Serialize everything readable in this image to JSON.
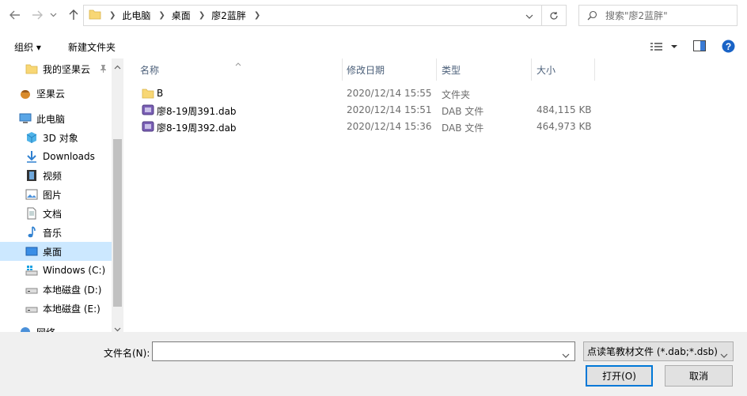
{
  "address": {
    "crumbs": [
      "此电脑",
      "桌面",
      "廖2蓝胖"
    ]
  },
  "search": {
    "placeholder": "搜索\"廖2蓝胖\""
  },
  "toolbar": {
    "organize_label": "组织 ▾",
    "new_folder_label": "新建文件夹"
  },
  "sidebar": {
    "items": [
      {
        "label": "我的坚果云",
        "icon": "folder-icon",
        "pinned": true
      },
      {
        "label": "坚果云",
        "icon": "nut-icon"
      },
      {
        "label": "此电脑",
        "icon": "computer-icon"
      },
      {
        "label": "3D 对象",
        "icon": "cube-icon"
      },
      {
        "label": "Downloads",
        "icon": "download-arrow-icon"
      },
      {
        "label": "视频",
        "icon": "film-icon"
      },
      {
        "label": "图片",
        "icon": "picture-icon"
      },
      {
        "label": "文档",
        "icon": "document-icon"
      },
      {
        "label": "音乐",
        "icon": "music-note-icon"
      },
      {
        "label": "桌面",
        "icon": "desktop-icon",
        "selected": true
      },
      {
        "label": "Windows (C:)",
        "icon": "windows-drive-icon"
      },
      {
        "label": "本地磁盘 (D:)",
        "icon": "drive-icon"
      },
      {
        "label": "本地磁盘 (E:)",
        "icon": "drive-icon"
      },
      {
        "label": "网络",
        "icon": "network-icon"
      }
    ]
  },
  "columns": {
    "name": "名称",
    "date": "修改日期",
    "type": "类型",
    "size": "大小"
  },
  "files": [
    {
      "name": "B",
      "date": "2020/12/14 15:55",
      "type": "文件夹",
      "size": "",
      "icon": "folder-icon"
    },
    {
      "name": "廖8-19周391.dab",
      "date": "2020/12/14 15:51",
      "type": "DAB 文件",
      "size": "484,115 KB",
      "icon": "dab-file-icon"
    },
    {
      "name": "廖8-19周392.dab",
      "date": "2020/12/14 15:36",
      "type": "DAB 文件",
      "size": "464,973 KB",
      "icon": "dab-file-icon"
    }
  ],
  "bottom": {
    "filename_label": "文件名(N):",
    "filename_value": "",
    "filetype_value": "点读笔教材文件 (*.dab;*.dsb)",
    "open_label": "打开(O)",
    "cancel_label": "取消"
  },
  "colors": {
    "selection": "#cce8ff",
    "folder": "#f8d775",
    "accent": "#0078d7"
  }
}
